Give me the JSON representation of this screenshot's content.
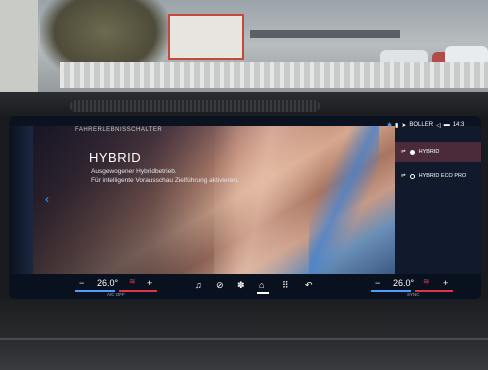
{
  "header": {
    "eyebrow": "FAHRERLEBNISSCHALTER"
  },
  "status_bar": {
    "location": "BOLLER",
    "time": "14:3"
  },
  "mode_panel": {
    "title": "HYBRID",
    "description_line1": "Ausgewogener Hybridbetrieb.",
    "description_line2": "Für intelligente Vorausschau Zielführung aktivieren."
  },
  "mode_options": [
    {
      "label": "HYBRID",
      "selected": true
    },
    {
      "label": "HYBRID ECO PRO",
      "selected": false
    }
  ],
  "climate": {
    "left_temp": "26.0°",
    "right_temp": "26.0°",
    "left_mini_label": "A/C OFF",
    "right_mini_label": "SYNC",
    "minus": "−",
    "plus": "+"
  },
  "dock": {
    "music_icon": "♫",
    "nav_icon": "⊘",
    "fan_icon": "✽",
    "home_icon": "⌂",
    "apps_icon": "⠿",
    "back_icon": "↶"
  },
  "colors": {
    "accent_blue": "#4f9cff",
    "selected_mode_bg": "#4b2a3a",
    "heat_red": "#e0344a"
  }
}
